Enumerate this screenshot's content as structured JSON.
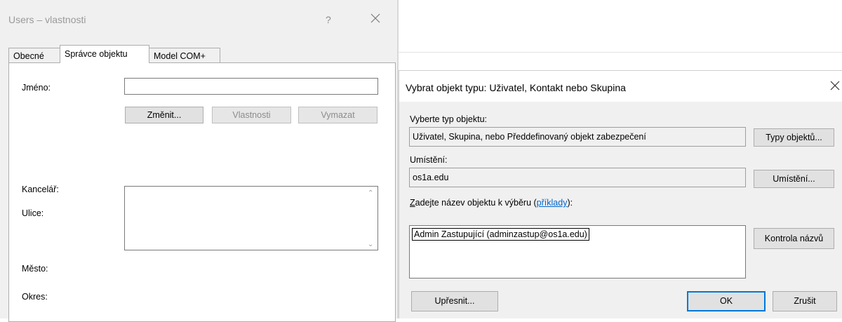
{
  "left": {
    "title": "Users – vlastnosti",
    "help": "?",
    "tabs": [
      "Obecné",
      "Správce objektu",
      "Model COM+"
    ],
    "name_label": "Jméno:",
    "change_button": "Změnit...",
    "properties_button": "Vlastnosti",
    "clear_button": "Vymazat",
    "office_label": "Kancelář:",
    "street_label": "Ulice:",
    "city_label": "Město:",
    "county_label": "Okres:"
  },
  "dialog": {
    "title": "Vybrat objekt typu: Uživatel, Kontakt nebo Skupina",
    "object_type_label": "Vyberte typ objektu:",
    "object_type_value": "Uživatel, Skupina, nebo Předdefinovaný objekt zabezpečení",
    "object_types_button": "Typy objektů...",
    "location_label": "Umístění:",
    "location_value": "os1a.edu",
    "locations_button": "Umístění...",
    "enter_names_prefix": "Z",
    "enter_names_rest": "adejte název objektu k výběru (",
    "examples_link": "příklady",
    "enter_names_suffix": "):",
    "names_value": "Admin Zastupující (adminzastup@os1a.edu)",
    "check_names_button": "Kontrola názvů",
    "advanced_button": "Upřesnit...",
    "ok_button": "OK",
    "cancel_button": "Zrušit"
  }
}
